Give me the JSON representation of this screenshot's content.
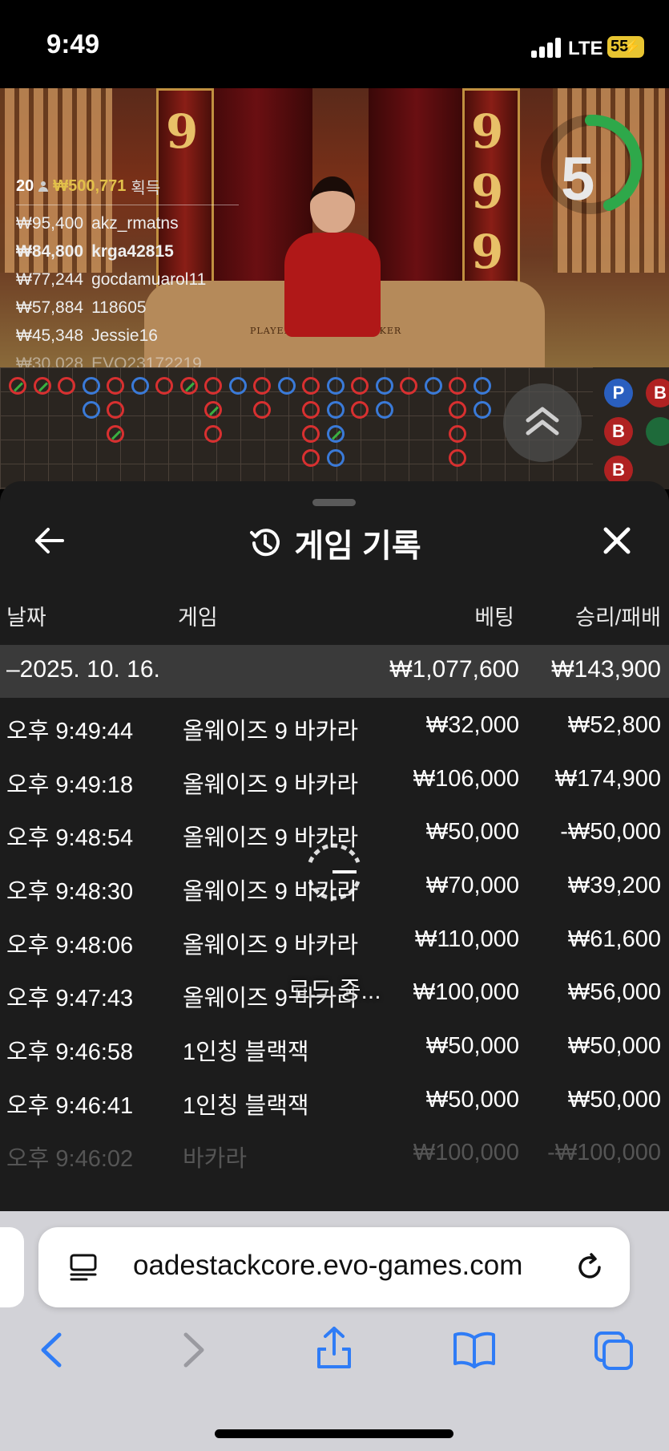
{
  "status_bar": {
    "time": "9:49",
    "network": "LTE",
    "battery": "55"
  },
  "video": {
    "timer": "5",
    "table_labels": [
      "PLAYER",
      "BANKER"
    ],
    "ranking": {
      "count": "20",
      "total": "₩500,771",
      "total_label": "획득",
      "rows": [
        {
          "amount": "₩95,400",
          "user": "akz_rmatns"
        },
        {
          "amount": "₩84,800",
          "user": "krga42815"
        },
        {
          "amount": "₩77,244",
          "user": "gocdamuarol11"
        },
        {
          "amount": "₩57,884",
          "user": "118605"
        },
        {
          "amount": "₩45,348",
          "user": "Jessie16"
        },
        {
          "amount": "₩30,028",
          "user": "EVO23172219"
        }
      ]
    }
  },
  "road": {
    "side_labels": [
      "P",
      "B",
      "B",
      "B"
    ]
  },
  "sheet": {
    "title": "게임 기록",
    "columns": {
      "date": "날짜",
      "game": "게임",
      "bet": "베팅",
      "result": "승리/패배"
    },
    "date_group": {
      "date": "–2025. 10. 16.",
      "bet": "₩1,077,600",
      "result": "₩143,900"
    },
    "rows": [
      {
        "time": "오후 9:49:44",
        "game": "올웨이즈 9 바카라",
        "bet": "₩32,000",
        "result": "₩52,800"
      },
      {
        "time": "오후 9:49:18",
        "game": "올웨이즈 9 바카라",
        "bet": "₩106,000",
        "result": "₩174,900"
      },
      {
        "time": "오후 9:48:54",
        "game": "올웨이즈 9 바카라",
        "bet": "₩50,000",
        "result": "-₩50,000"
      },
      {
        "time": "오후 9:48:30",
        "game": "올웨이즈 9 바카라",
        "bet": "₩70,000",
        "result": "₩39,200"
      },
      {
        "time": "오후 9:48:06",
        "game": "올웨이즈 9 바카라",
        "bet": "₩110,000",
        "result": "₩61,600"
      },
      {
        "time": "오후 9:47:43",
        "game": "올웨이즈 9 바카라",
        "bet": "₩100,000",
        "result": "₩56,000"
      },
      {
        "time": "오후 9:46:58",
        "game": "1인칭 블랙잭",
        "bet": "₩50,000",
        "result": "₩50,000"
      },
      {
        "time": "오후 9:46:41",
        "game": "1인칭 블랙잭",
        "bet": "₩50,000",
        "result": "₩50,000"
      },
      {
        "time": "오후 9:46:02",
        "game": "바카라",
        "bet": "₩100,000",
        "result": "-₩100,000"
      }
    ],
    "loading_text": "로드 중..."
  },
  "browser": {
    "url": "oadestackcore.evo-games.com"
  },
  "colors": {
    "player": "#3a7ad8",
    "banker": "#d83030",
    "tie": "#3ab040",
    "gold": "#e2c04a"
  }
}
